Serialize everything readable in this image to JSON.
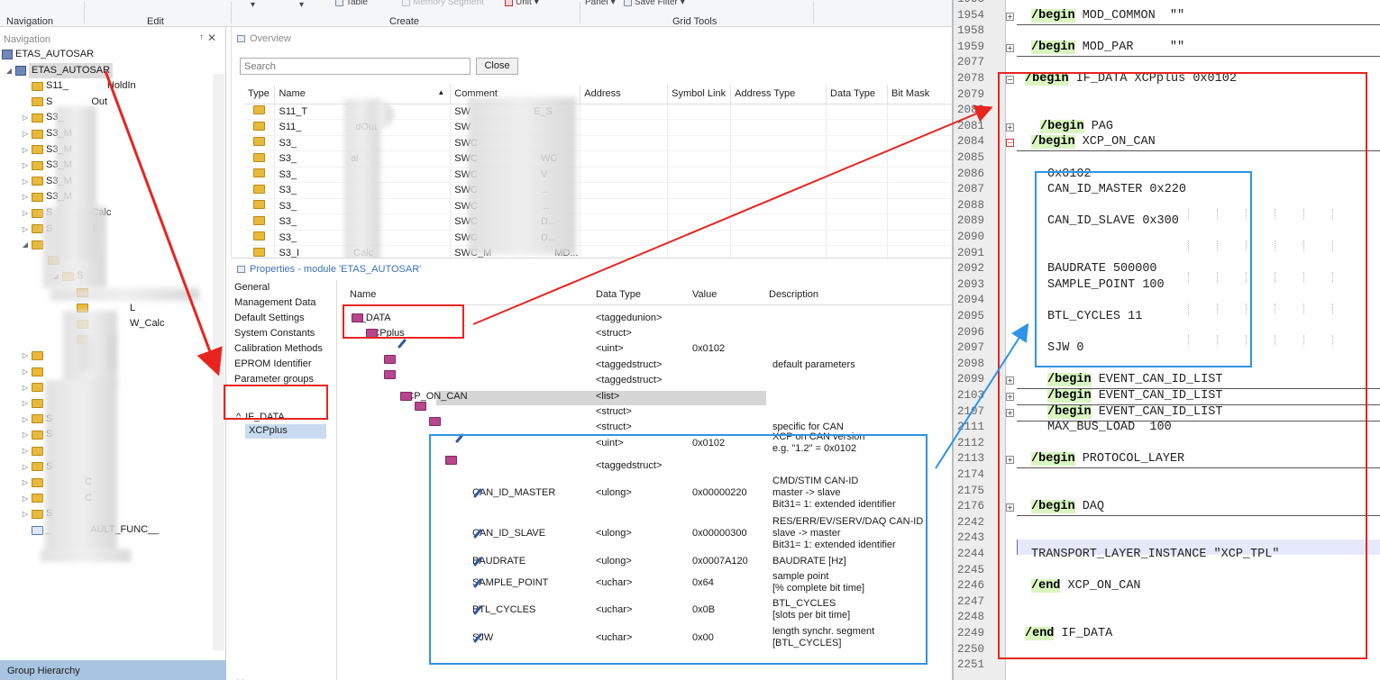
{
  "ribbon": {
    "groups": [
      "Navigation",
      "Edit",
      "Create",
      "Grid Tools"
    ],
    "top_items": {
      "table": "Table",
      "memory_segment": "Memory Segment",
      "unit": "Unit",
      "panel": "Panel",
      "save_filter": "Save Filter"
    }
  },
  "nav": {
    "title": "Navigation",
    "pin": "↑",
    "close": "✕",
    "tree": [
      {
        "label": "ETAS_AUTOSAR",
        "icon": "module",
        "level": 0
      },
      {
        "label": "ETAS_AUTOSAR",
        "icon": "module",
        "level": 1,
        "selected": true
      },
      {
        "label": "S11_",
        "suffix": "HoldIn",
        "level": 2
      },
      {
        "label": "S",
        "suffix": "Out",
        "level": 2
      },
      {
        "label": "S3_",
        "level": 2
      },
      {
        "label": "S3_M",
        "level": 2
      },
      {
        "label": "S3_M",
        "level": 2
      },
      {
        "label": "S3_M",
        "level": 2
      },
      {
        "label": "S3_M",
        "level": 2
      },
      {
        "label": "S3_M",
        "level": 2
      },
      {
        "label": "S",
        "suffix": "Calc",
        "level": 2
      },
      {
        "label": "S",
        "suffix": "1",
        "level": 2
      },
      {
        "label": "",
        "level": 2
      },
      {
        "label": "",
        "level": 3
      },
      {
        "label": "S",
        "level": 4
      },
      {
        "label": "",
        "level": 5
      },
      {
        "label": "",
        "suffix": "L",
        "level": 5
      },
      {
        "label": "",
        "suffix": "W_Calc",
        "level": 5
      },
      {
        "label": "",
        "level": 5
      },
      {
        "label": "",
        "level": 2
      },
      {
        "label": "",
        "level": 2
      },
      {
        "label": "",
        "level": 2
      },
      {
        "label": "",
        "level": 2
      },
      {
        "label": "S",
        "level": 2
      },
      {
        "label": "S",
        "level": 2
      },
      {
        "label": "",
        "level": 2
      },
      {
        "label": "S",
        "level": 2
      },
      {
        "label": "",
        "suffix": "C",
        "level": 2
      },
      {
        "label": "",
        "suffix": "C",
        "level": 2
      },
      {
        "label": "S",
        "level": 2
      },
      {
        "label": "_",
        "suffix": "AULT_FUNC__",
        "level": 2
      }
    ],
    "bottom_tab": "Group Hierarchy"
  },
  "overview": {
    "title": "Overview",
    "search_placeholder": "Search",
    "close_label": "Close",
    "columns": [
      "Type",
      "Name",
      "Comment",
      "Address",
      "Symbol Link",
      "Address Type",
      "Data Type",
      "Bit Mask"
    ],
    "rows": [
      {
        "name": "S11_T",
        "comment": "SW",
        "comment_end": "E_S"
      },
      {
        "name": "S11_",
        "name_end": "dOut",
        "comment": "SW"
      },
      {
        "name": "S3_",
        "comment": "SWC"
      },
      {
        "name": "S3_",
        "name_end": "al",
        "comment": "SWC",
        "comment_end": "WC"
      },
      {
        "name": "S3_",
        "comment": "SWC",
        "comment_end": "V"
      },
      {
        "name": "S3_",
        "comment": "SWC",
        "comment_end": "..."
      },
      {
        "name": "S3_",
        "comment": "SWC",
        "comment_end": "..."
      },
      {
        "name": "S3_",
        "comment": "SWC",
        "comment_end": "D..."
      },
      {
        "name": "S3_",
        "comment": "SWC",
        "comment_end": "D..."
      },
      {
        "name": "S3_I",
        "name_end": "Calc",
        "comment": "SWC_M",
        "comment_end": "MD..."
      }
    ]
  },
  "properties": {
    "title": "Properties - module 'ETAS_AUTOSAR'",
    "sections": [
      "General",
      "Management Data",
      "Default Settings",
      "System Constants",
      "Calibration Methods",
      "EPROM Identifier",
      "Parameter groups"
    ],
    "group": {
      "label": "IF_DATA",
      "child": "XCPplus"
    },
    "columns": [
      "Name",
      "Data Type",
      "Value",
      "Description"
    ],
    "rows": [
      {
        "name": "IF_DATA",
        "type": "<taggedunion>",
        "value": "",
        "desc": ""
      },
      {
        "name": "XCPplus",
        "type": "<struct>",
        "value": "",
        "desc": ""
      },
      {
        "name": "",
        "type": "<uint>",
        "value": "0x0102",
        "desc": ""
      },
      {
        "name": "",
        "type": "<taggedstruct>",
        "value": "",
        "desc": "default parameters"
      },
      {
        "name": "",
        "type": "<taggedstruct>",
        "value": "",
        "desc": ""
      },
      {
        "name": "XCP_ON_CAN",
        "type": "<list>",
        "value": "",
        "desc": ""
      },
      {
        "name": "",
        "type": "<struct>",
        "value": "",
        "desc": ""
      },
      {
        "name": "",
        "type": "<struct>",
        "value": "",
        "desc": "specific for CAN"
      },
      {
        "name": "",
        "type": "<uint>",
        "value": "0x0102",
        "desc": "XCP on CAN version",
        "desc2": "e.g. \"1.2\" = 0x0102"
      },
      {
        "name": "",
        "type": "<taggedstruct>",
        "value": "",
        "desc": ""
      },
      {
        "name": "CAN_ID_MASTER",
        "type": "<ulong>",
        "value": "0x00000220",
        "desc": "CMD/STIM CAN-ID",
        "desc2": "master -> slave",
        "desc3": "Bit31= 1: extended identifier"
      },
      {
        "name": "CAN_ID_SLAVE",
        "type": "<ulong>",
        "value": "0x00000300",
        "desc": "RES/ERR/EV/SERV/DAQ CAN-ID",
        "desc2": "slave -> master",
        "desc3": "Bit31= 1: extended identifier"
      },
      {
        "name": "BAUDRATE",
        "type": "<ulong>",
        "value": "0x0007A120",
        "desc": "BAUDRATE [Hz]"
      },
      {
        "name": "SAMPLE_POINT",
        "type": "<uchar>",
        "value": "0x64",
        "desc": "sample point",
        "desc2": "[% complete bit time]"
      },
      {
        "name": "BTL_CYCLES",
        "type": "<uchar>",
        "value": "0x0B",
        "desc": "BTL_CYCLES",
        "desc2": "[slots per bit time]"
      },
      {
        "name": "SJW",
        "type": "<uchar>",
        "value": "0x00",
        "desc": "length synchr. segment",
        "desc2": "[BTL_CYCLES]"
      }
    ],
    "bottom_partial": "M"
  },
  "editor": {
    "lines": [
      {
        "n": "1953",
        "text": ""
      },
      {
        "n": "1954",
        "kw": "/begin",
        "text": " MOD_COMMON  \"\""
      },
      {
        "n": "1958",
        "text": ""
      },
      {
        "n": "1959",
        "kw": "/begin",
        "text": " MOD_PAR     \"\""
      },
      {
        "n": "2077",
        "text": ""
      },
      {
        "n": "2078",
        "kw": "/begin",
        "text": " IF_DATA XCPplus 0x0102"
      },
      {
        "n": "2079",
        "text": ""
      },
      {
        "n": "2080",
        "text": ""
      },
      {
        "n": "2081",
        "kw": "/begin",
        "text": " PAG"
      },
      {
        "n": "2084",
        "kw": "/begin",
        "text": " XCP_ON_CAN"
      },
      {
        "n": "2085",
        "text": ""
      },
      {
        "n": "2086",
        "text": "0x0102"
      },
      {
        "n": "2087",
        "text": "CAN_ID_MASTER 0x220"
      },
      {
        "n": "2088",
        "text": ""
      },
      {
        "n": "2089",
        "text": "CAN_ID_SLAVE 0x300"
      },
      {
        "n": "2090",
        "text": ""
      },
      {
        "n": "2091",
        "text": ""
      },
      {
        "n": "2092",
        "text": "BAUDRATE 500000"
      },
      {
        "n": "2093",
        "text": "SAMPLE_POINT 100"
      },
      {
        "n": "2094",
        "text": ""
      },
      {
        "n": "2095",
        "text": "BTL_CYCLES 11"
      },
      {
        "n": "2096",
        "text": ""
      },
      {
        "n": "2097",
        "text": "SJW 0"
      },
      {
        "n": "2098",
        "text": ""
      },
      {
        "n": "2099",
        "kw": "/begin",
        "text": " EVENT_CAN_ID_LIST"
      },
      {
        "n": "2103",
        "kw": "/begin",
        "text": " EVENT_CAN_ID_LIST"
      },
      {
        "n": "2107",
        "kw": "/begin",
        "text": " EVENT_CAN_ID_LIST"
      },
      {
        "n": "2111",
        "text": "MAX_BUS_LOAD  100"
      },
      {
        "n": "2112",
        "text": ""
      },
      {
        "n": "2113",
        "kw": "/begin",
        "text": " PROTOCOL_LAYER"
      },
      {
        "n": "2174",
        "text": ""
      },
      {
        "n": "2175",
        "text": ""
      },
      {
        "n": "2176",
        "kw": "/begin",
        "text": " DAQ"
      },
      {
        "n": "2242",
        "text": ""
      },
      {
        "n": "2243",
        "text": ""
      },
      {
        "n": "2244",
        "text": "TRANSPORT_LAYER_INSTANCE \"XCP_TPL\""
      },
      {
        "n": "2245",
        "text": ""
      },
      {
        "n": "2246",
        "kw": "/end",
        "text": " XCP_ON_CAN"
      },
      {
        "n": "2247",
        "text": ""
      },
      {
        "n": "2248",
        "text": ""
      },
      {
        "n": "2249",
        "kw": "/end",
        "text": " IF_DATA"
      },
      {
        "n": "2250",
        "text": ""
      },
      {
        "n": "2251",
        "text": ""
      }
    ]
  },
  "colors": {
    "annotation_red": "#e8241f",
    "annotation_blue": "#2f93e8",
    "keyword_bg": "#d9f5c0",
    "selection_blue": "#c8dcf0",
    "group_tab": "#a9c4e0"
  }
}
